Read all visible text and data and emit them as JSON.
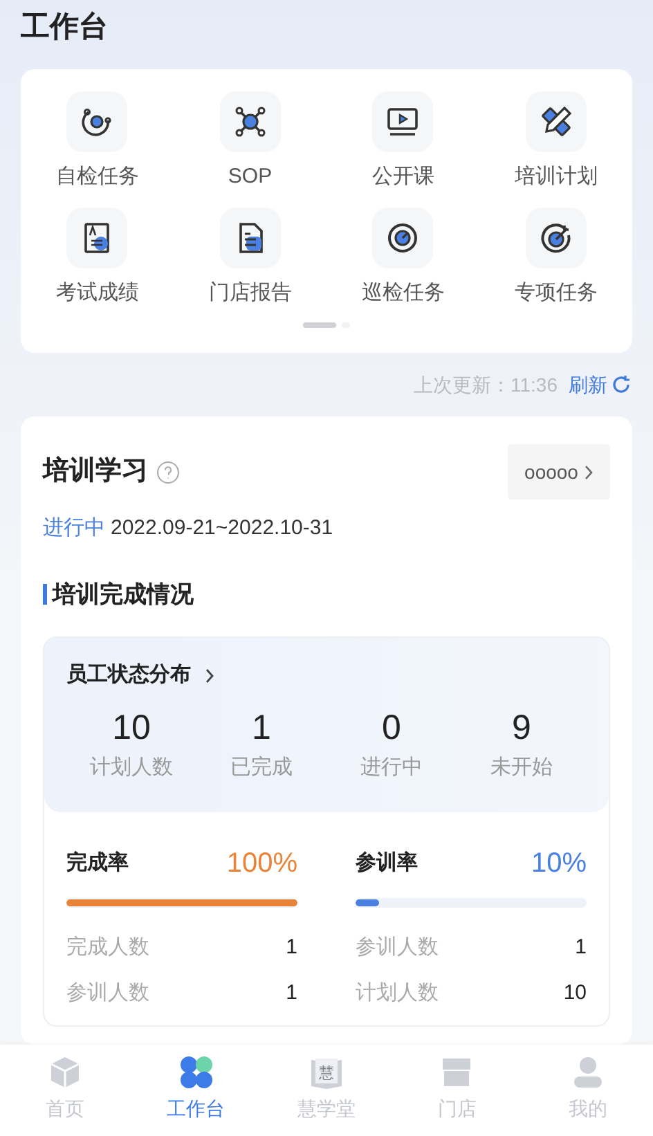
{
  "header": {
    "title": "工作台"
  },
  "shortcuts": [
    {
      "label": "自检任务",
      "kind": "orbit"
    },
    {
      "label": "SOP",
      "kind": "network"
    },
    {
      "label": "公开课",
      "kind": "video"
    },
    {
      "label": "培训计划",
      "kind": "pencil"
    },
    {
      "label": "考试成绩",
      "kind": "paper"
    },
    {
      "label": "门店报告",
      "kind": "report"
    },
    {
      "label": "巡检任务",
      "kind": "target"
    },
    {
      "label": "专项任务",
      "kind": "dart"
    }
  ],
  "pager": [
    {
      "selected": true
    },
    {
      "selected": false
    }
  ],
  "update": {
    "label": "上次更新：11:36",
    "action": "刷新"
  },
  "training": {
    "title": "培训学习",
    "selector": "ooooo",
    "status": "进行中",
    "date_range": "2022.09-21~2022.10-31",
    "section_title": "培训完成情况",
    "distribution": {
      "title": "员工状态分布",
      "stats": [
        {
          "value": "10",
          "label": "计划人数"
        },
        {
          "value": "1",
          "label": "已完成"
        },
        {
          "value": "0",
          "label": "进行中"
        },
        {
          "value": "9",
          "label": "未开始"
        }
      ]
    },
    "rates": [
      {
        "title": "完成率",
        "value": "100%",
        "level": 1.0,
        "color": "#e8843a",
        "rows": [
          {
            "label": "完成人数",
            "value": "1"
          },
          {
            "label": "参训人数",
            "value": "1"
          }
        ]
      },
      {
        "title": "参训率",
        "value": "10%",
        "level": 0.1,
        "color": "#4a80e0",
        "rows": [
          {
            "label": "参训人数",
            "value": "1"
          },
          {
            "label": "计划人数",
            "value": "10"
          }
        ]
      }
    ]
  },
  "tab_bar": [
    {
      "label": "首页",
      "kind": "cube",
      "selected": false
    },
    {
      "label": "工作台",
      "kind": "clover",
      "selected": true
    },
    {
      "label": "慧学堂",
      "kind": "book",
      "icon_text": "慧",
      "selected": false
    },
    {
      "label": "门店",
      "kind": "shop",
      "selected": false
    },
    {
      "label": "我的",
      "kind": "person",
      "selected": false
    }
  ]
}
